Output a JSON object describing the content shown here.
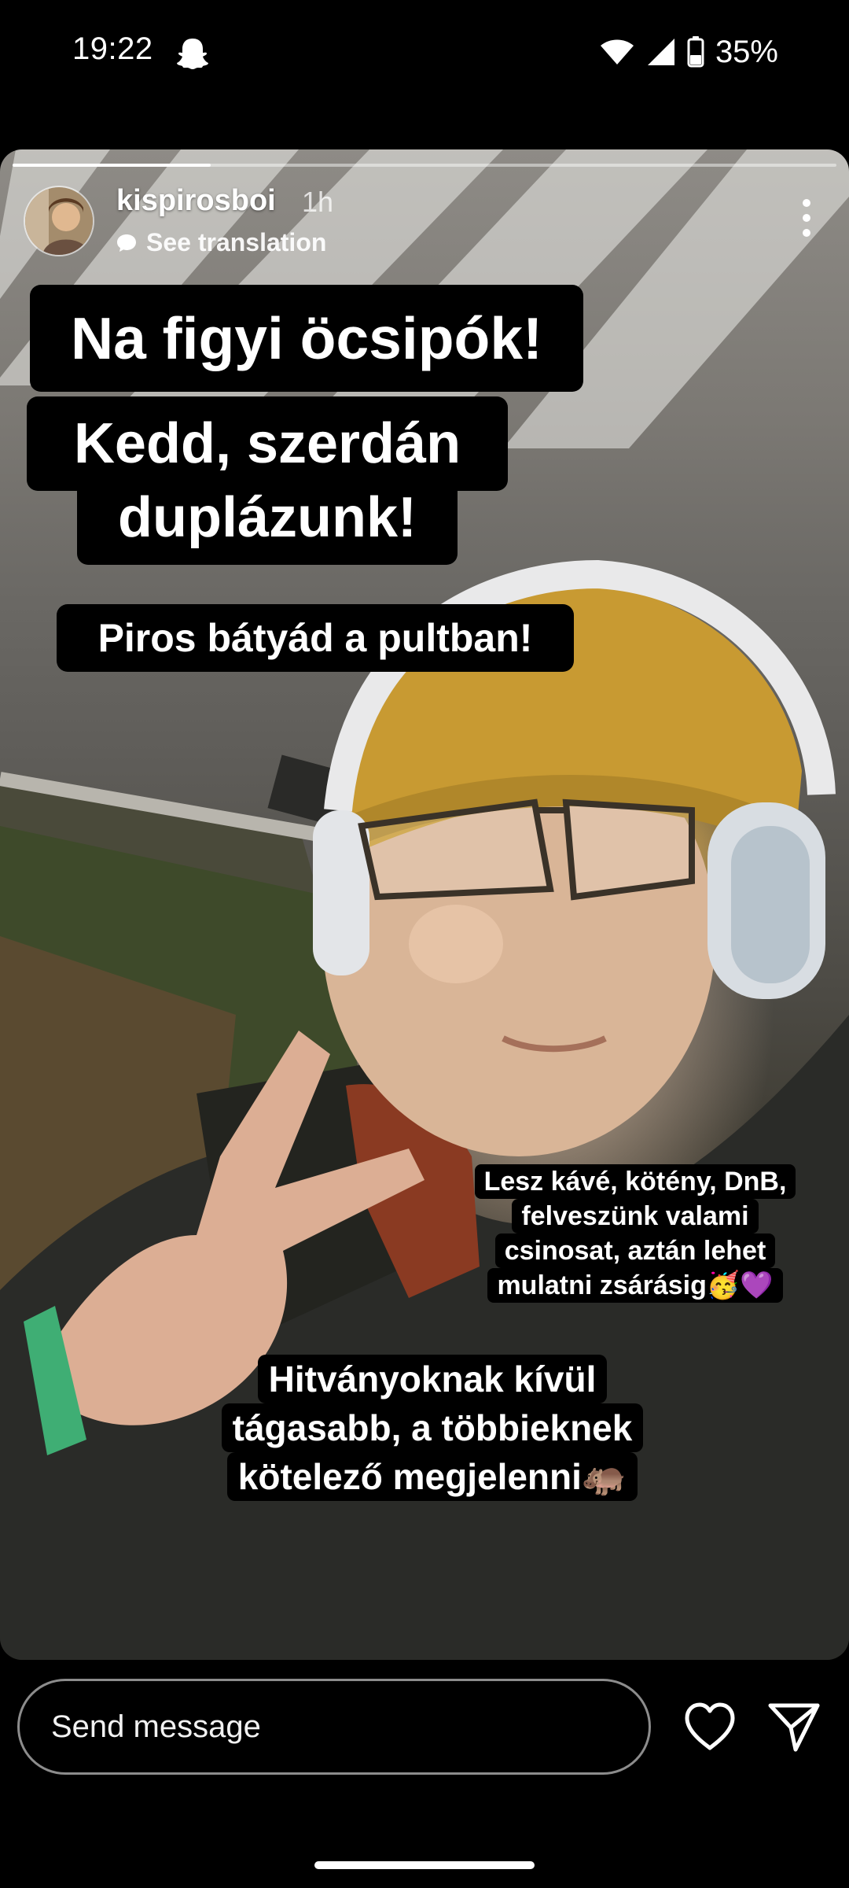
{
  "status_bar": {
    "time": "19:22",
    "battery": "35%",
    "icons": [
      "snapchat-notification-icon",
      "wifi-icon",
      "signal-icon",
      "battery-icon"
    ]
  },
  "story": {
    "progress": 0.24,
    "username": "kispirosboi",
    "time_ago": "1h",
    "see_translation": "See translation",
    "captions": {
      "line1": "Na figyi öcsipók!",
      "line2a": "Kedd, szerdán",
      "line2b": "duplázunk!",
      "line3": "Piros bátyád a pultban!",
      "block1": [
        "Lesz kávé, kötény, DnB,",
        "felveszünk valami",
        "csinosat, aztán lehet",
        "mulatni zsárásig🥳💜"
      ],
      "block2": [
        "Hitványoknak kívül",
        "tágasabb, a többieknek",
        "kötelező megjelenni🦛"
      ]
    }
  },
  "bottom_bar": {
    "message_placeholder": "Send message",
    "icons": [
      "heart-icon",
      "send-icon"
    ]
  }
}
